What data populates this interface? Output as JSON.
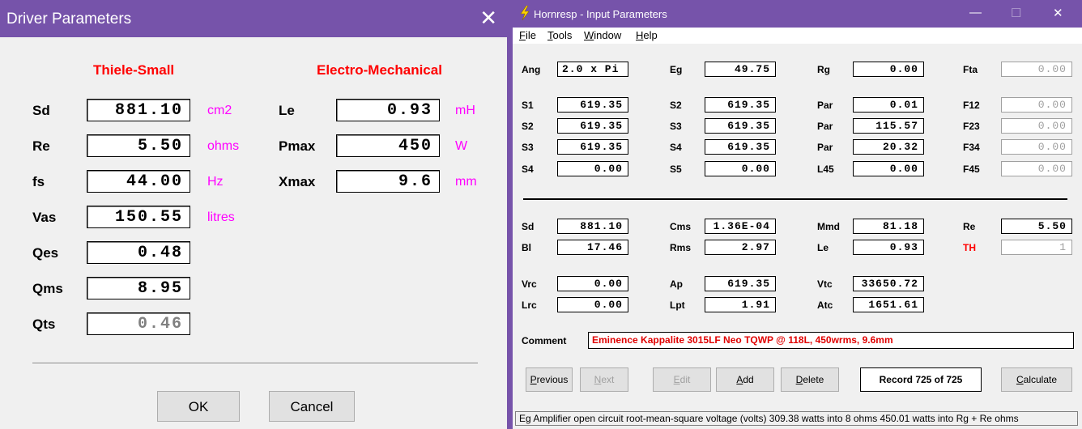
{
  "driver": {
    "title": "Driver Parameters",
    "close_glyph": "✕",
    "head_ts": "Thiele-Small",
    "head_em": "Electro-Mechanical",
    "ts": [
      {
        "label": "Sd",
        "value": "881.10",
        "unit": "cm2"
      },
      {
        "label": "Re",
        "value": "5.50",
        "unit": "ohms"
      },
      {
        "label": "fs",
        "value": "44.00",
        "unit": "Hz"
      },
      {
        "label": "Vas",
        "value": "150.55",
        "unit": "litres"
      },
      {
        "label": "Qes",
        "value": "0.48",
        "unit": ""
      },
      {
        "label": "Qms",
        "value": "8.95",
        "unit": ""
      },
      {
        "label": "Qts",
        "value": "0.46",
        "unit": ""
      }
    ],
    "em": [
      {
        "label": "Le",
        "value": "0.93",
        "unit": "mH"
      },
      {
        "label": "Pmax",
        "value": "450",
        "unit": "W"
      },
      {
        "label": "Xmax",
        "value": "9.6",
        "unit": "mm"
      }
    ],
    "ok_label": "OK",
    "cancel_label": "Cancel"
  },
  "hornresp": {
    "title": "Hornresp - Input Parameters",
    "minimize": "—",
    "maximize": "☐",
    "close": "✕",
    "menu": [
      {
        "key": "F",
        "rest": "ile"
      },
      {
        "key": "T",
        "rest": "ools"
      },
      {
        "key": "W",
        "rest": "indow"
      },
      {
        "key": "H",
        "rest": "elp"
      }
    ],
    "top": {
      "ang_label": "Ang",
      "ang": "2.0 x Pi",
      "eg_label": "Eg",
      "eg": "49.75",
      "rg_label": "Rg",
      "rg": "0.00",
      "fta_label": "Fta",
      "fta": "0.00"
    },
    "horn_rows": [
      {
        "a": "S1",
        "av": "619.35",
        "b": "S2",
        "bv": "619.35",
        "c": "Par",
        "cv": "0.01",
        "d": "F12",
        "dv": "0.00"
      },
      {
        "a": "S2",
        "av": "619.35",
        "b": "S3",
        "bv": "619.35",
        "c": "Par",
        "cv": "115.57",
        "d": "F23",
        "dv": "0.00"
      },
      {
        "a": "S3",
        "av": "619.35",
        "b": "S4",
        "bv": "619.35",
        "c": "Par",
        "cv": "20.32",
        "d": "F34",
        "dv": "0.00"
      },
      {
        "a": "S4",
        "av": "0.00",
        "b": "S5",
        "bv": "0.00",
        "c": "L45",
        "cv": "0.00",
        "d": "F45",
        "dv": "0.00"
      }
    ],
    "drv_rows": [
      {
        "a": "Sd",
        "av": "881.10",
        "b": "Cms",
        "bv": "1.36E-04",
        "c": "Mmd",
        "cv": "81.18",
        "d": "Re",
        "dv": "5.50"
      },
      {
        "a": "Bl",
        "av": "17.46",
        "b": "Rms",
        "bv": "2.97",
        "c": "Le",
        "cv": "0.93",
        "d": "TH",
        "dv": "1"
      }
    ],
    "enc_rows": [
      {
        "a": "Vrc",
        "av": "0.00",
        "b": "Ap",
        "bv": "619.35",
        "c": "Vtc",
        "cv": "33650.72"
      },
      {
        "a": "Lrc",
        "av": "0.00",
        "b": "Lpt",
        "bv": "1.91",
        "c": "Atc",
        "cv": "1651.61"
      }
    ],
    "comment_label": "Comment",
    "comment": "Eminence Kappalite 3015LF Neo TQWP @ 118L, 450wrms, 9.6mm",
    "buttons": {
      "previous": {
        "key": "P",
        "rest": "revious"
      },
      "next": {
        "key": "N",
        "rest": "ext"
      },
      "edit": {
        "key": "E",
        "rest": "dit"
      },
      "add": {
        "key": "A",
        "rest": "dd"
      },
      "delete": {
        "key": "D",
        "rest": "elete"
      },
      "calculate": {
        "key": "C",
        "rest": "alculate"
      }
    },
    "record": "Record 725 of 725",
    "status": "Eg  Amplifier open circuit root-mean-square voltage  (volts)   309.38 watts into 8 ohms   450.01 watts into Rg + Re ohms"
  },
  "colors": {
    "accent": "#7653aa",
    "ts_red": "#ff0000",
    "unit_magenta": "#ff00ff"
  }
}
